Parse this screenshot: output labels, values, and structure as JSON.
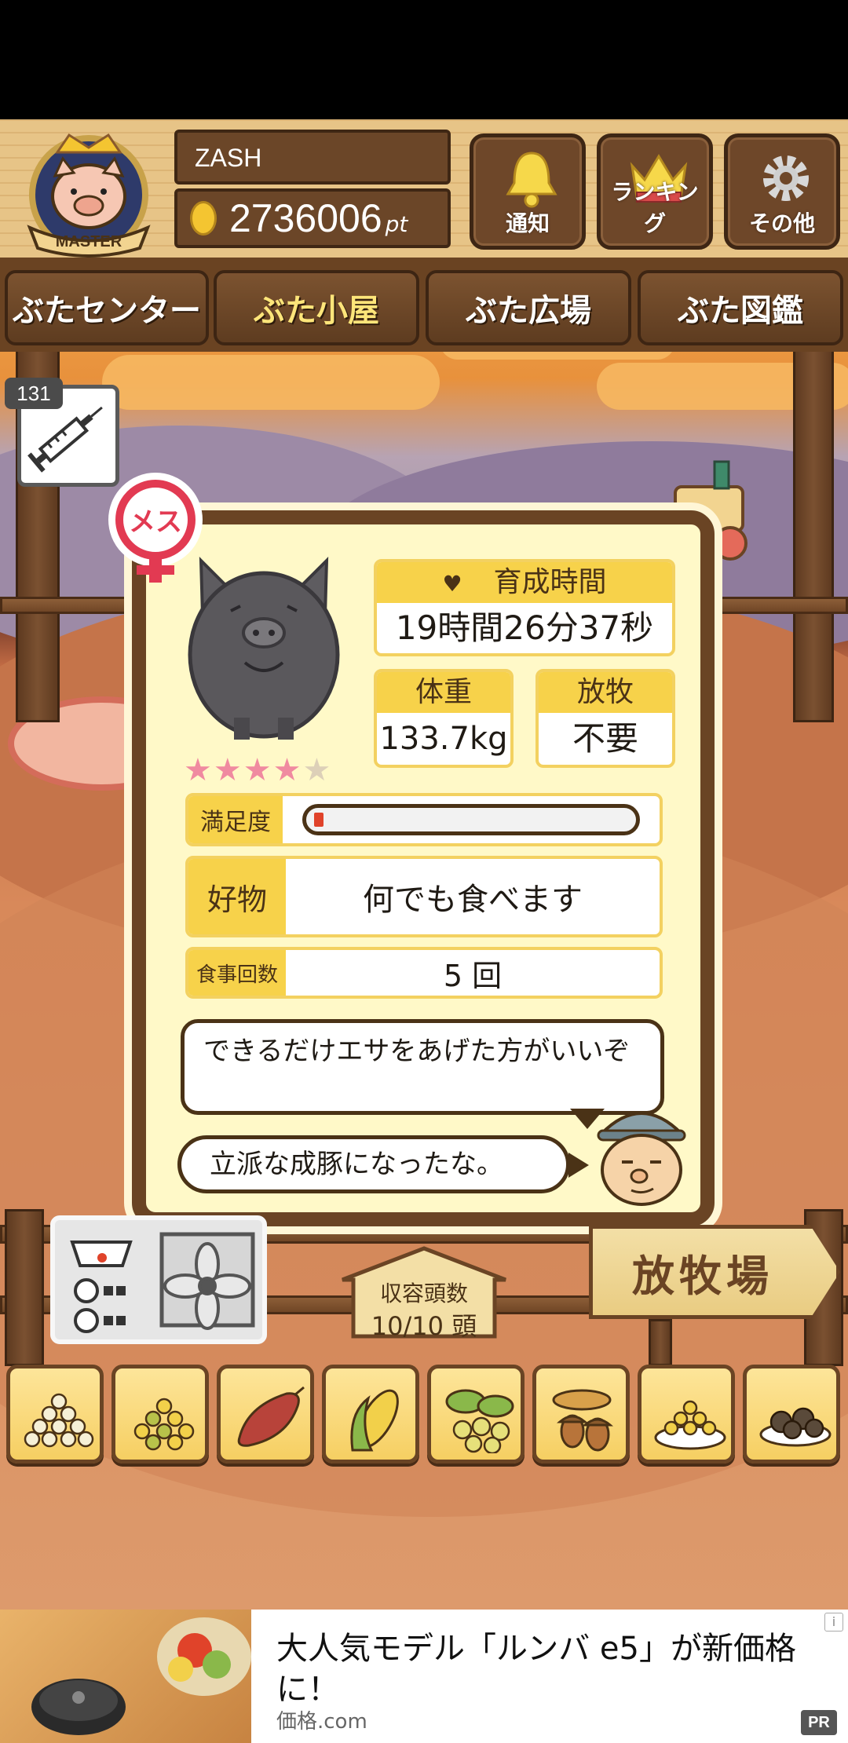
{
  "header": {
    "badge_label": "MASTER",
    "player_name": "ZASH",
    "points_value": "2736006",
    "points_unit": "pt",
    "buttons": [
      {
        "label": "通知",
        "icon": "bell-icon"
      },
      {
        "label": "ランキング",
        "icon": "crown-icon"
      },
      {
        "label": "その他",
        "icon": "gear-icon"
      }
    ]
  },
  "nav": {
    "tabs": [
      {
        "label": "ぶたセンター"
      },
      {
        "label": "ぶた小屋"
      },
      {
        "label": "ぶた広場"
      },
      {
        "label": "ぶた図鑑"
      }
    ]
  },
  "item_counter": "131",
  "pig_card": {
    "gender_label": "メス",
    "rating": {
      "value": 4,
      "max": 5
    },
    "growth_time": {
      "label": "育成時間",
      "value": "19時間26分37秒"
    },
    "weight": {
      "label": "体重",
      "value": "133.7kg"
    },
    "grazing": {
      "label": "放牧",
      "value": "不要"
    },
    "satisfaction": {
      "label": "満足度",
      "level": 0.03
    },
    "favorite": {
      "label": "好物",
      "value": "何でも食べます"
    },
    "meals": {
      "label": "食事回数",
      "value": "5 回"
    },
    "advice_bubble": "できるだけエサをあげた方がいいぞ",
    "comment_bubble": "立派な成豚になったな。"
  },
  "capacity_sign": {
    "label": "収容頭数",
    "value": "10/10 頭"
  },
  "grazing_sign": "放牧場",
  "food_items": [
    {
      "name": "grain-pile-icon"
    },
    {
      "name": "mixed-grain-icon"
    },
    {
      "name": "sweet-potato-icon"
    },
    {
      "name": "corn-icon"
    },
    {
      "name": "beans-leaves-icon"
    },
    {
      "name": "acorn-icon"
    },
    {
      "name": "grain-plate-icon"
    },
    {
      "name": "meatballs-plate-icon"
    }
  ],
  "ad": {
    "title": "大人気モデル「ルンバ e5」が新価格に！",
    "source": "価格.com",
    "pr": "PR",
    "info": "i"
  }
}
